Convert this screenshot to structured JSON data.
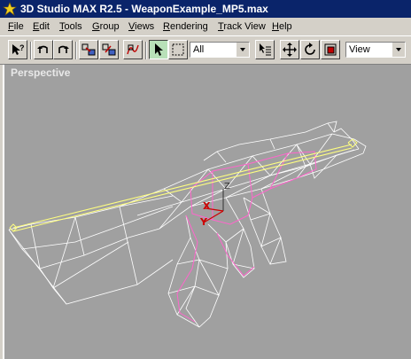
{
  "window": {
    "title": "3D Studio MAX R2.5 - WeaponExample_MP5.max"
  },
  "menu": [
    {
      "acc": "F",
      "rest": "ile"
    },
    {
      "acc": "E",
      "rest": "dit"
    },
    {
      "acc": "T",
      "rest": "ools"
    },
    {
      "acc": "G",
      "rest": "roup"
    },
    {
      "acc": "V",
      "rest": "iews"
    },
    {
      "acc": "R",
      "rest": "endering"
    },
    {
      "acc": "T",
      "rest": "rack View"
    },
    {
      "acc": "H",
      "rest": "elp"
    }
  ],
  "toolbar": {
    "selection_filter": "All",
    "reference_coord": "View",
    "icons": [
      "help-cursor-icon",
      "undo-icon",
      "redo-icon",
      "select-and-link-icon",
      "unlink-icon",
      "bind-space-warp-icon",
      "select-object-icon",
      "region-select-icon",
      "select-by-name-icon",
      "move-icon",
      "rotate-icon",
      "scale-icon"
    ]
  },
  "viewport": {
    "label": "Perspective",
    "gizmo": {
      "x": "X",
      "y": "Y",
      "z": "Z"
    },
    "colors": {
      "background": "#a0a0a0",
      "wireframe": "#ffffff",
      "selected": "#ffff80",
      "pink": "#ff66cc",
      "gizmo_x": "#cc0000"
    }
  }
}
